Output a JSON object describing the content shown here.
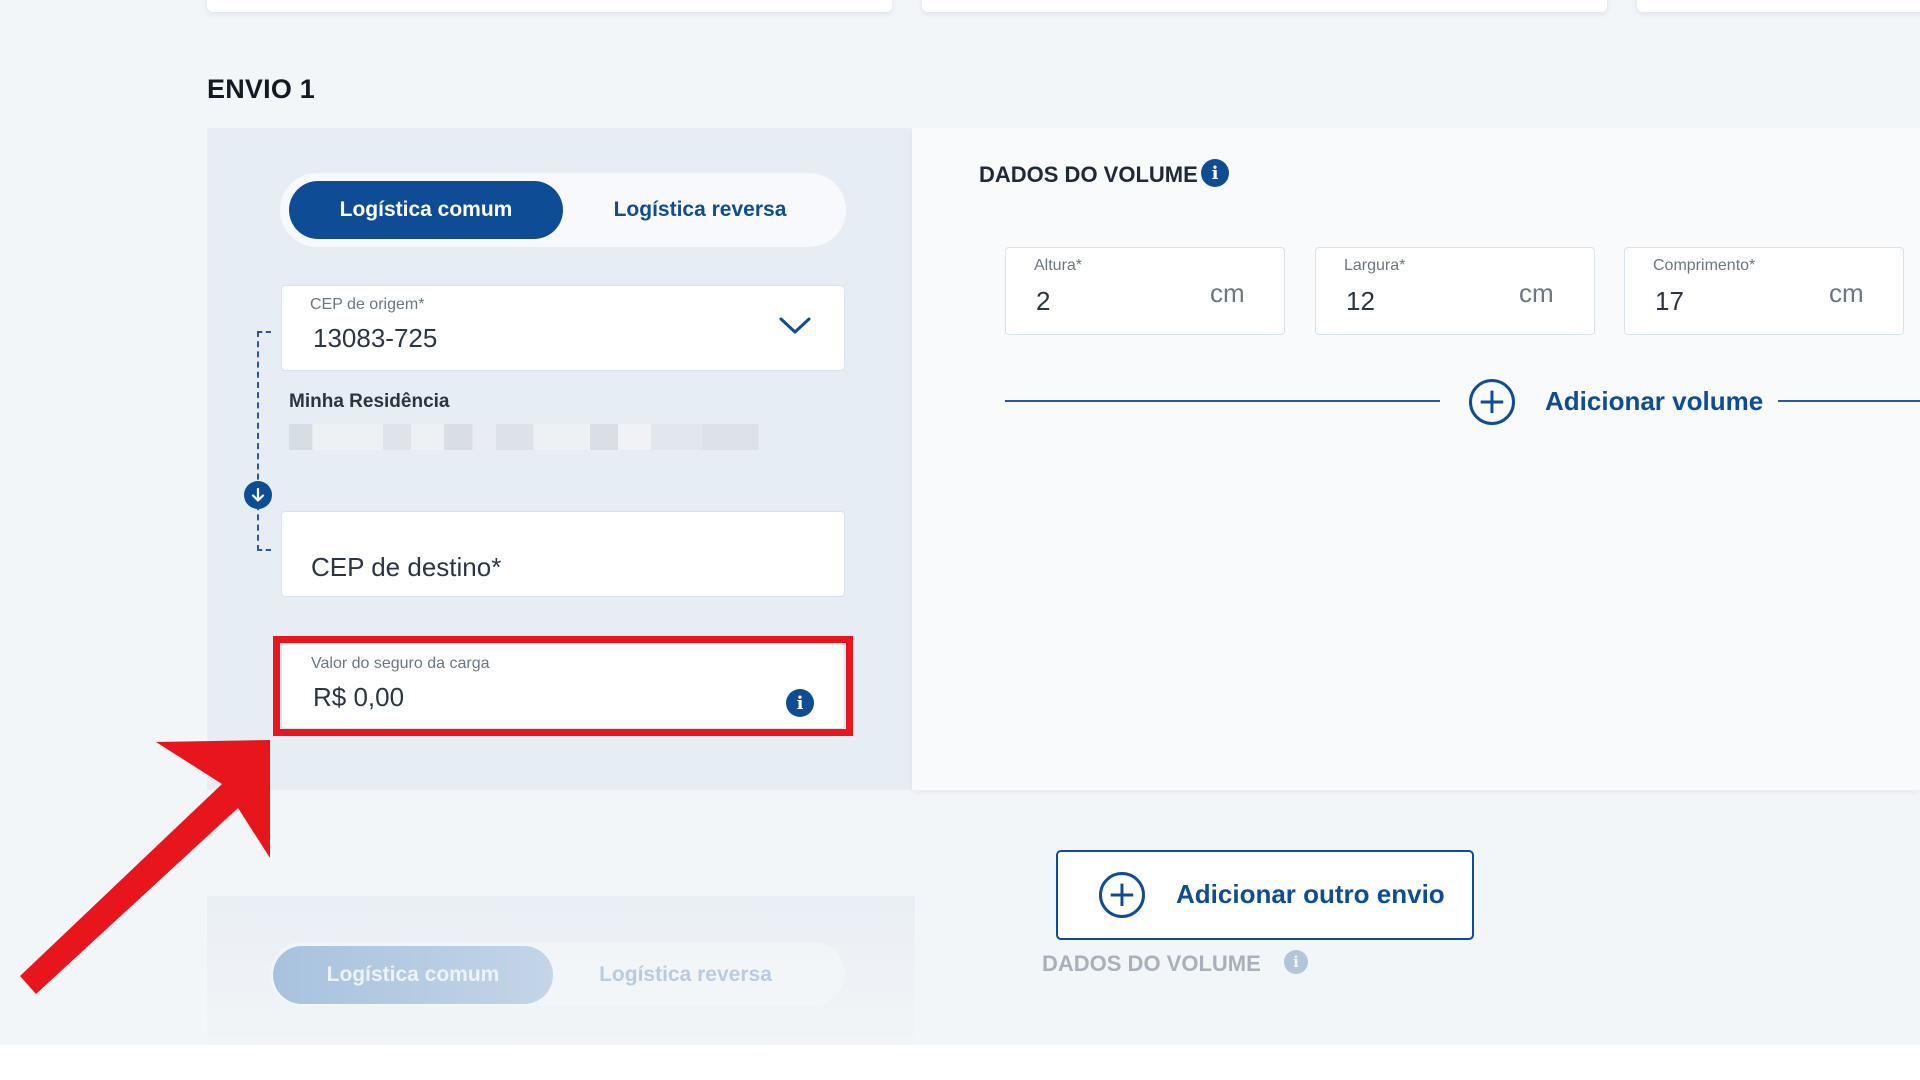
{
  "section": {
    "title": "ENVIO 1"
  },
  "logistics_toggle": {
    "common_label": "Logística comum",
    "reverse_label": "Logística reversa",
    "selected": "Logística comum"
  },
  "origin": {
    "label": "CEP de origem*",
    "value": "13083-725",
    "address_name": "Minha Residência"
  },
  "destination": {
    "placeholder": "CEP de destino*"
  },
  "insurance": {
    "label": "Valor do seguro da carga",
    "value": "R$ 0,00"
  },
  "volume": {
    "title": "DADOS DO VOLUME",
    "fields": [
      {
        "label": "Altura*",
        "value": "2",
        "unit": "cm"
      },
      {
        "label": "Largura*",
        "value": "12",
        "unit": "cm"
      },
      {
        "label": "Comprimento*",
        "value": "17",
        "unit": "cm"
      }
    ],
    "add_label": "Adicionar volume"
  },
  "add_envio": {
    "label": "Adicionar outro envio"
  },
  "next_envio": {
    "common_label": "Logística comum",
    "reverse_label": "Logística reversa",
    "volume_title": "DADOS DO VOLUME"
  },
  "colors": {
    "primary": "#0e4d96",
    "highlight": "#e8161c",
    "panel_left": "#e6edf4",
    "panel_right": "#f8fafc"
  },
  "icons": {
    "dropdown": "chevron-down-icon",
    "direction": "arrow-down-icon",
    "info": "info-icon",
    "add": "plus-circle-icon",
    "annotation": "red-arrow-icon"
  }
}
